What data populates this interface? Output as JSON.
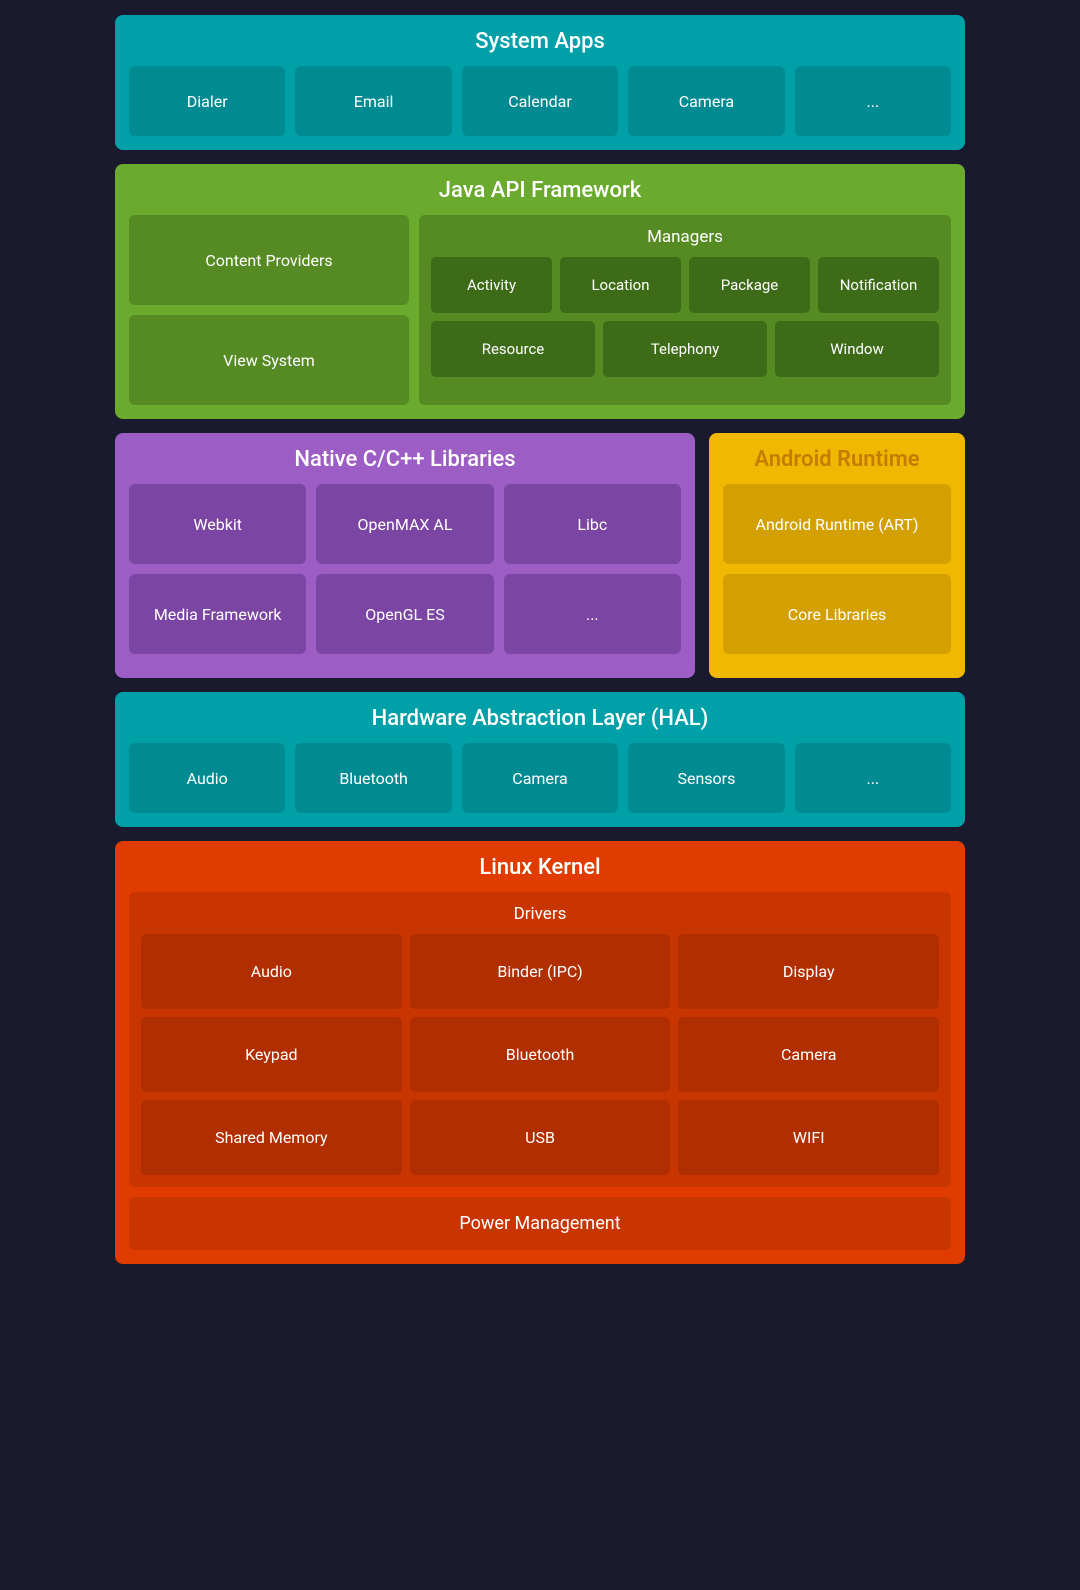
{
  "system_apps": {
    "title": "System Apps",
    "cells": [
      "Dialer",
      "Email",
      "Calendar",
      "Camera",
      "..."
    ]
  },
  "java_api": {
    "title": "Java API Framework",
    "left": [
      "Content Providers",
      "View System"
    ],
    "managers_title": "Managers",
    "managers_row1": [
      "Activity",
      "Location",
      "Package",
      "Notification"
    ],
    "managers_row2": [
      "Resource",
      "Telephony",
      "Window"
    ]
  },
  "native_cpp": {
    "title": "Native C/C++ Libraries",
    "row1": [
      "Webkit",
      "OpenMAX AL",
      "Libc"
    ],
    "row2": [
      "Media Framework",
      "OpenGL ES",
      "..."
    ]
  },
  "android_runtime": {
    "title": "Android Runtime",
    "cells": [
      "Android Runtime (ART)",
      "Core Libraries"
    ]
  },
  "hal": {
    "title": "Hardware Abstraction Layer (HAL)",
    "cells": [
      "Audio",
      "Bluetooth",
      "Camera",
      "Sensors",
      "..."
    ]
  },
  "linux_kernel": {
    "title": "Linux Kernel",
    "drivers_title": "Drivers",
    "row1": [
      "Audio",
      "Binder (IPC)",
      "Display"
    ],
    "row2": [
      "Keypad",
      "Bluetooth",
      "Camera"
    ],
    "row3": [
      "Shared Memory",
      "USB",
      "WIFI"
    ],
    "power_management": "Power Management"
  }
}
